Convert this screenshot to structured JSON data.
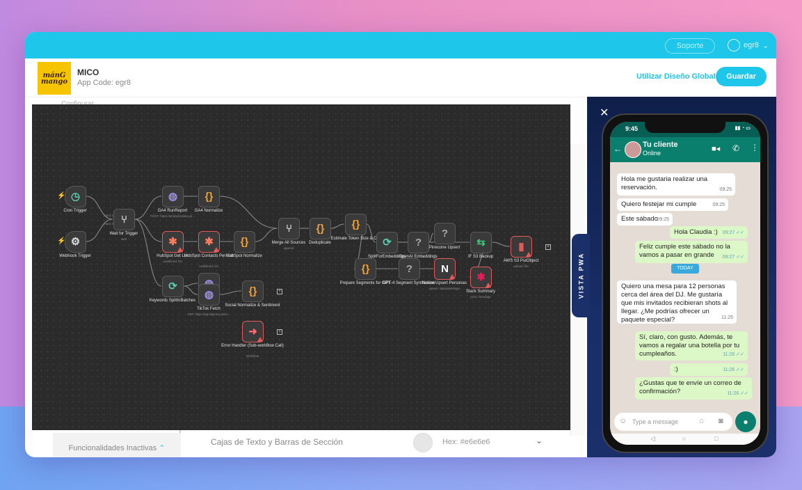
{
  "topbar": {
    "soporte": "Soporte",
    "user": "egr8"
  },
  "header": {
    "logo_lines": [
      "mánG",
      "mango"
    ],
    "app_name": "MICO",
    "app_code": "App Code: egr8",
    "global_design": "Utilizar Diseño Global",
    "save": "Guardar"
  },
  "strip_text": "Configurar",
  "workflow": {
    "nodes": [
      {
        "id": "cron",
        "label": "Cron Trigger",
        "sub": "",
        "icon": "◷",
        "color": "#5ccbb0",
        "red": false
      },
      {
        "id": "webhook",
        "label": "Webhook Trigger",
        "sub": "",
        "icon": "⚙",
        "color": "#ddd",
        "red": false
      },
      {
        "id": "wait",
        "label": "Wait for Trigger",
        "sub": "wait",
        "icon": "⑂",
        "color": "#ddd",
        "red": false
      },
      {
        "id": "ga4run",
        "label": "GA4 RunReport",
        "sub": "POST: https://analyticsdata.go...",
        "icon": "◍",
        "color": "#9a8cf2",
        "red": false
      },
      {
        "id": "ga4norm",
        "label": "GA4 Normalize",
        "sub": "",
        "icon": "{}",
        "color": "#f2a33a",
        "red": false
      },
      {
        "id": "hsget",
        "label": "HubSpot Get List",
        "sub": "undefined: list",
        "icon": "✱",
        "color": "#ff7a59",
        "red": true
      },
      {
        "id": "hscontacts",
        "label": "HubSpot Contacts Per List",
        "sub": "undefined: list",
        "icon": "✱",
        "color": "#ff7a59",
        "red": true
      },
      {
        "id": "hsnorm",
        "label": "HubSpot Normalize",
        "sub": "",
        "icon": "{}",
        "color": "#f2a33a",
        "red": false
      },
      {
        "id": "kwsplit",
        "label": "Keywords SplitInBatches",
        "sub": "",
        "icon": "⟳",
        "color": "#5ccbb0",
        "red": false
      },
      {
        "id": "ga4dup",
        "label": "",
        "sub": "",
        "icon": "◍",
        "color": "#9a8cf2",
        "red": false
      },
      {
        "id": "tiktok",
        "label": "TikTok Fetch",
        "sub": "GET: https://api.tikproxy.io/wi...",
        "icon": "◍",
        "color": "#9a8cf2",
        "red": false
      },
      {
        "id": "socialnorm",
        "label": "Social Normalize & Sentiment",
        "sub": "",
        "icon": "{}",
        "color": "#f2a33a",
        "red": false
      },
      {
        "id": "errh",
        "label": "Error Handler (Sub-workflow Call)",
        "sub": "Workflow",
        "icon": "➜",
        "color": "#ff6a6a",
        "red": true
      },
      {
        "id": "merge",
        "label": "Merge All Sources",
        "sub": "append",
        "icon": "⑂",
        "color": "#ddd",
        "red": false
      },
      {
        "id": "dedup",
        "label": "Deduplicate",
        "sub": "",
        "icon": "{}",
        "color": "#f2a33a",
        "red": false
      },
      {
        "id": "estimate",
        "label": "Estimate Token Size & C...",
        "sub": "",
        "icon": "{}",
        "color": "#f2a33a",
        "red": false
      },
      {
        "id": "splitemb",
        "label": "SplitForEmbeddings",
        "sub": "",
        "icon": "⟳",
        "color": "#5ccbb0",
        "red": false
      },
      {
        "id": "openai",
        "label": "OpenAI Embeddings",
        "sub": "",
        "icon": "?",
        "color": "#aaa",
        "red": false
      },
      {
        "id": "pinecone",
        "label": "Pinecone Upsert",
        "sub": "",
        "icon": "?",
        "color": "#aaa",
        "red": false
      },
      {
        "id": "prepare",
        "label": "Prepare Segments for GPT",
        "sub": "",
        "icon": "{}",
        "color": "#f2a33a",
        "red": false
      },
      {
        "id": "gpt4",
        "label": "GPT-4 Segment Synthesizer",
        "sub": "",
        "icon": "?",
        "color": "#aaa",
        "red": false
      },
      {
        "id": "notion",
        "label": "Notion Upsert Personas",
        "sub": "upsert: databasePage",
        "icon": "N",
        "color": "#fff",
        "red": true
      },
      {
        "id": "ifs3",
        "label": "IF S3 Backup",
        "sub": "",
        "icon": "⇆",
        "color": "#3ec97a",
        "red": false
      },
      {
        "id": "slack",
        "label": "Slack Summary",
        "sub": "post: message",
        "icon": "✱",
        "color": "#e01e5a",
        "red": true
      },
      {
        "id": "aws",
        "label": "AWS S3 PutObject",
        "sub": "upload: file",
        "icon": "▮",
        "color": "#e35a5a",
        "red": true
      }
    ],
    "port_labels": {
      "input1": "Input 1",
      "input2": "Input 2"
    }
  },
  "bottom": {
    "inactive": "Funcionalidades Inactivas",
    "section": "Cajas de Texto y Barras de Sección",
    "hex": "Hex: #e6e6e6"
  },
  "pwa": {
    "vista_label": "VISTA PWA",
    "time": "9:45",
    "contact": "Tu cliente",
    "status": "Online",
    "today": "TODAY",
    "input_placeholder": "Type a message",
    "messages": [
      {
        "dir": "in",
        "text": "Hola me gustaria realizar una reservación.",
        "time": "09:25"
      },
      {
        "dir": "in",
        "text": "Quiero festejar mi cumple",
        "time": "09:25"
      },
      {
        "dir": "in",
        "text": "Este sábado",
        "time": "09:25"
      },
      {
        "dir": "out",
        "text": "Hola Claudia :)",
        "time": "09:27 ✓✓"
      },
      {
        "dir": "out",
        "text": "Feliz cumple este sábado no la vamos a pasar en grande",
        "time": "09:27 ✓✓"
      },
      {
        "dir": "in",
        "text": "Quiero una mesa para 12 personas cerca del área del DJ. Me gustaría que mis invitados recibieran shots al llegar. ¿Me podrías ofrecer un paquete especial?",
        "time": "11:25"
      },
      {
        "dir": "out",
        "text": "Sí, claro, con gusto. Además, te vamos a regalar una botella por tu cumpleaños.",
        "time": "11:26 ✓✓"
      },
      {
        "dir": "out",
        "text": ":)",
        "time": "11:26 ✓✓"
      },
      {
        "dir": "out",
        "text": "¿Gustas que te envíe un correo de confirmación?",
        "time": "11:26 ✓✓"
      }
    ]
  }
}
